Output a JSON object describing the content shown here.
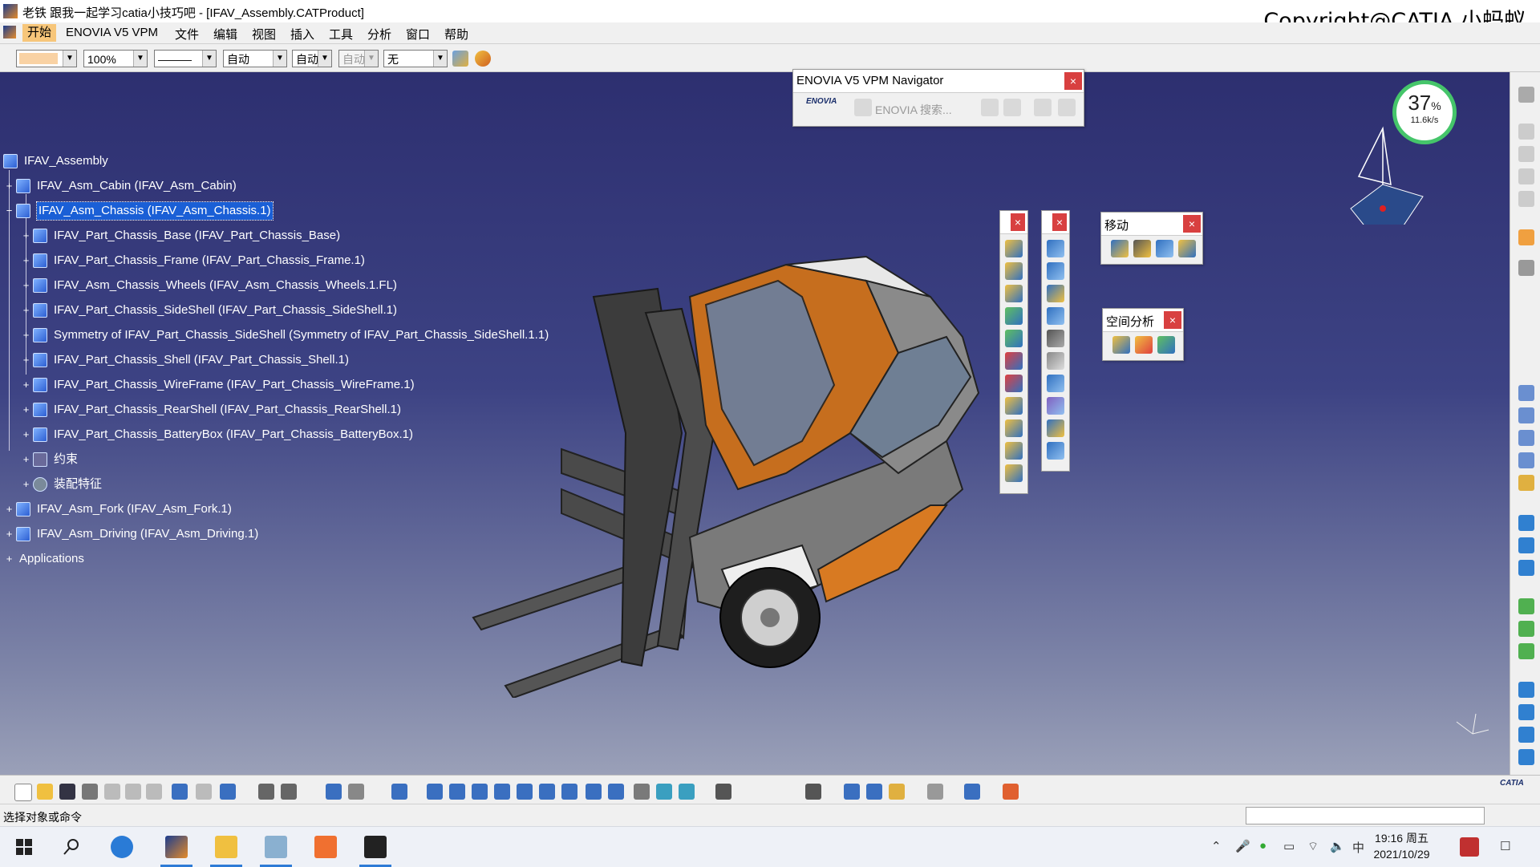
{
  "window": {
    "title": "老铁 跟我一起学习catia小技巧吧 - [IFAV_Assembly.CATProduct]",
    "copyright": "Copyright@CATIA 小蚂蚁",
    "controls": "– ▫ ×"
  },
  "menu": [
    "开始",
    "ENOVIA V5 VPM",
    "文件",
    "编辑",
    "视图",
    "插入",
    "工具",
    "分析",
    "窗口",
    "帮助"
  ],
  "format_toolbar": {
    "color": "",
    "zoom": "100%",
    "line_type": "———",
    "thickness": "自动",
    "layer": "自动",
    "linewidth": "自动",
    "filter": "无"
  },
  "tree": {
    "root": "IFAV_Assembly",
    "items": [
      {
        "label": "IFAV_Asm_Cabin (IFAV_Asm_Cabin)",
        "expander": "+"
      },
      {
        "label": "IFAV_Asm_Chassis (IFAV_Asm_Chassis.1)",
        "expander": "−",
        "selected": true
      },
      {
        "label": "IFAV_Part_Chassis_Base (IFAV_Part_Chassis_Base)",
        "expander": "+"
      },
      {
        "label": "IFAV_Part_Chassis_Frame (IFAV_Part_Chassis_Frame.1)",
        "expander": "+"
      },
      {
        "label": "IFAV_Asm_Chassis_Wheels (IFAV_Asm_Chassis_Wheels.1.FL)",
        "expander": "+"
      },
      {
        "label": "IFAV_Part_Chassis_SideShell (IFAV_Part_Chassis_SideShell.1)",
        "expander": "+"
      },
      {
        "label": "Symmetry of IFAV_Part_Chassis_SideShell (Symmetry of IFAV_Part_Chassis_SideShell.1.1)",
        "expander": "+"
      },
      {
        "label": "IFAV_Part_Chassis_Shell (IFAV_Part_Chassis_Shell.1)",
        "expander": "+"
      },
      {
        "label": "IFAV_Part_Chassis_WireFrame (IFAV_Part_Chassis_WireFrame.1)",
        "expander": "+"
      },
      {
        "label": "IFAV_Part_Chassis_RearShell (IFAV_Part_Chassis_RearShell.1)",
        "expander": "+"
      },
      {
        "label": "IFAV_Part_Chassis_BatteryBox (IFAV_Part_Chassis_BatteryBox.1)",
        "expander": "+"
      },
      {
        "label": "约束",
        "expander": "+"
      },
      {
        "label": "装配特征",
        "expander": "+"
      },
      {
        "label": "IFAV_Asm_Fork (IFAV_Asm_Fork.1)",
        "expander": "+"
      },
      {
        "label": "IFAV_Asm_Driving (IFAV_Asm_Driving.1)",
        "expander": "+"
      },
      {
        "label": "Applications",
        "expander": "+"
      }
    ]
  },
  "panels": {
    "enovia": {
      "title": "ENOVIA V5 VPM Navigator",
      "search_label": "ENOVIA 搜索...",
      "logo": "ENOVIA"
    },
    "move": {
      "title": "移动"
    },
    "space_analysis": {
      "title": "空间分析"
    },
    "close": "×"
  },
  "perf_gauge": {
    "percent": "37",
    "unit": "%",
    "speed": "11.6k/s"
  },
  "status": {
    "prompt": "选择对象或命令"
  },
  "clock": {
    "time": "19:16 周五",
    "date": "2021/10/29"
  },
  "tray_ime": "中",
  "catia_logo": "CATIA",
  "colors": {
    "viewport_top": "#2d2f70",
    "viewport_bottom": "#9aa0b8",
    "selection": "#1a5fd6",
    "menu_active": "#f7c67a"
  }
}
